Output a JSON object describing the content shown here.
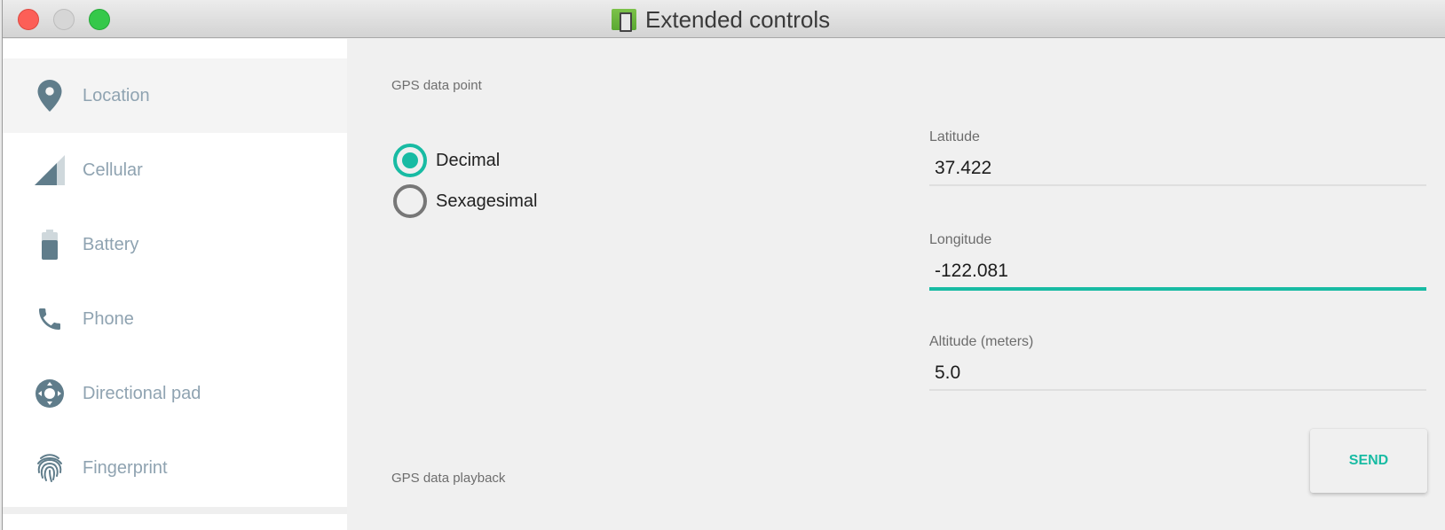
{
  "window": {
    "title": "Extended controls",
    "controls": {
      "close": "close",
      "minimize": "minimize",
      "zoom": "zoom"
    }
  },
  "sidebar": {
    "items": [
      {
        "label": "Location",
        "icon": "location-pin-icon",
        "active": true
      },
      {
        "label": "Cellular",
        "icon": "cellular-signal-icon",
        "active": false
      },
      {
        "label": "Battery",
        "icon": "battery-icon",
        "active": false
      },
      {
        "label": "Phone",
        "icon": "phone-icon",
        "active": false
      },
      {
        "label": "Directional pad",
        "icon": "dpad-icon",
        "active": false
      },
      {
        "label": "Fingerprint",
        "icon": "fingerprint-icon",
        "active": false
      }
    ]
  },
  "main": {
    "gps_point_title": "GPS data point",
    "format_options": [
      {
        "label": "Decimal",
        "checked": true
      },
      {
        "label": "Sexagesimal",
        "checked": false
      }
    ],
    "fields": {
      "latitude": {
        "label": "Latitude",
        "value": "37.422"
      },
      "longitude": {
        "label": "Longitude",
        "value": "-122.081",
        "focused": true
      },
      "altitude": {
        "label": "Altitude (meters)",
        "value": "5.0"
      }
    },
    "send_label": "SEND",
    "gps_playback_title": "GPS data playback"
  },
  "colors": {
    "accent": "#18bba3",
    "icon": "#607d8b",
    "nav_label": "#8fa3b1"
  }
}
